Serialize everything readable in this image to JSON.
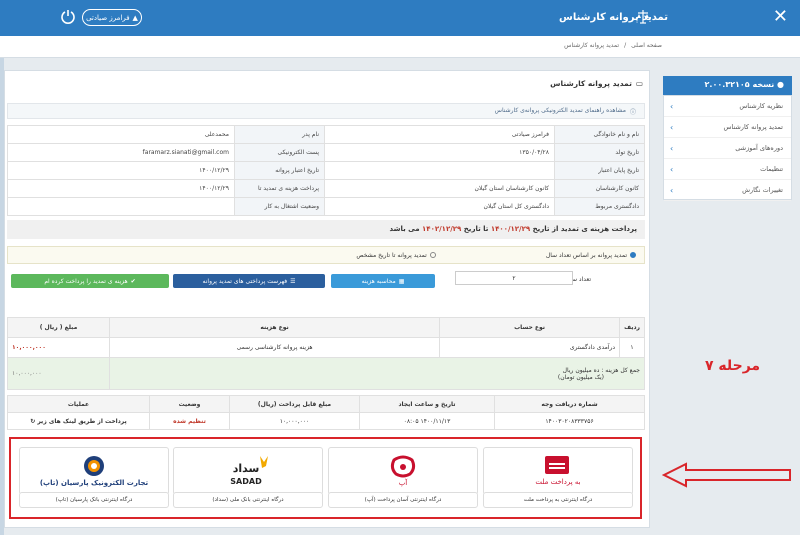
{
  "header": {
    "title": "تمدید پروانه کارشناس",
    "close_icon": "close-icon",
    "user_name": "فرامرز صیادتی",
    "power_icon": "power-icon"
  },
  "breadcrumb": [
    "صفحه اصلی",
    "تمدید پروانه کارشناس"
  ],
  "sidebar": {
    "header": "نسخه ۲.۰۰.۳۲۱۰۵",
    "items": [
      {
        "label": "نظریه کارشناس"
      },
      {
        "label": "تمدید پروانه کارشناس"
      },
      {
        "label": "دوره‌های آموزشی"
      },
      {
        "label": "تنظیمات"
      },
      {
        "label": "تغییرات نگارش"
      }
    ]
  },
  "main": {
    "title": "تمدید پروانه کارشناس",
    "guide": "مشاهده راهنمای تمدید الکترونیکی پروانه‌ی کارشناس",
    "info_rows": [
      {
        "l1": "نام و نام خانوادگی",
        "v1": "فرامرز صیادتی",
        "l2": "نام پدر",
        "v2": "محمدعلی"
      },
      {
        "l1": "تاریخ تولد",
        "v1": "۱۳۵۰/۰۴/۲۸",
        "l2": "پست الکترونیکی",
        "v2": "faramarz.sianati@gmail.com"
      },
      {
        "l1": "تاریخ پایان اعتبار",
        "v1": "",
        "l2": "تاریخ اعتبار پروانه",
        "v2": "۱۴۰۰/۱۲/۲۹"
      },
      {
        "l1": "کانون کارشناسان",
        "v1": "کانون کارشناسان استان گیلان",
        "l2": "پرداخت هزینه ی تمدید تا",
        "v2": "۱۴۰۰/۱۲/۲۹"
      },
      {
        "l1": "دادگستری مربوط",
        "v1": "دادگستری کل استان گیلان",
        "l2": "وضعیت اشتغال به کار",
        "v2": ""
      }
    ],
    "fee_notice": {
      "prefix": "پرداخت هزینه ی تمدید از تاریخ",
      "from": "۱۴۰۰/۱۲/۲۹",
      "mid": "تا تاریخ",
      "to": "۱۴۰۲/۱۲/۲۹",
      "suffix": "می باشد"
    },
    "options": {
      "by_years": "تمدید پروانه بر اساس تعداد سال",
      "to_date": "تمدید پروانه تا تاریخ مشخص"
    },
    "years_label": "تعداد سال تمدید",
    "years_value": "۲",
    "buttons": {
      "calc": "محاسبه هزینه",
      "list": "فهرست پرداختی های تمدید پروانه",
      "paid": "هزینه ی تمدید را پرداخت کرده ام"
    },
    "fee_table": {
      "headers": [
        "ردیف",
        "نوع حساب",
        "نوع هزینه",
        "مبلغ ( ریال )"
      ],
      "rows": [
        {
          "idx": "۱",
          "account": "درآمدی دادگستری",
          "type": "هزینه پروانه کارشناسی رسمی",
          "amount": "۱۰,۰۰۰,۰۰۰"
        }
      ],
      "total_label": "جمع کل هزینه :",
      "total_words": "ده میلیون ریال",
      "total_words2": "(یک میلیون تومان)",
      "total_amount": "۱۰,۰۰۰,۰۰۰"
    },
    "pay_table": {
      "headers": [
        "شماره دریافت وجه",
        "تاریخ و ساعت ایجاد",
        "مبلغ قابل پرداخت (ریال)",
        "وضعیت",
        "عملیات"
      ],
      "row": {
        "receipt": "۱۴۰۰۳۰۲۰۸۳۳۳۷۵۶",
        "created": "۱۴۰۰/۱۱/۱۳ ۰۸:۰۵",
        "amount": "۱۰,۰۰۰,۰۰۰",
        "status": "تنظیم شده",
        "ops": "پرداخت از طریق لینک های زیر"
      }
    },
    "gateways": [
      {
        "logo": "به پرداخت ملت",
        "label": "درگاه اینترنتی به پرداخت ملت"
      },
      {
        "logo": "آپ",
        "label": "درگاه اینترنتی آسان پرداخت (آپ)"
      },
      {
        "logo": "سداد",
        "logo2": "SADAD",
        "label": "درگاه اینترنتی بانک ملی (سداد)"
      },
      {
        "logo": "تجارت الکترونیک پارسیان (تاپ)",
        "label": "درگاه اینترنتی بانک پارسیان (تاپ)"
      }
    ]
  },
  "annotation": {
    "stage": "مرحله ۷",
    "color": "#d9252a"
  }
}
